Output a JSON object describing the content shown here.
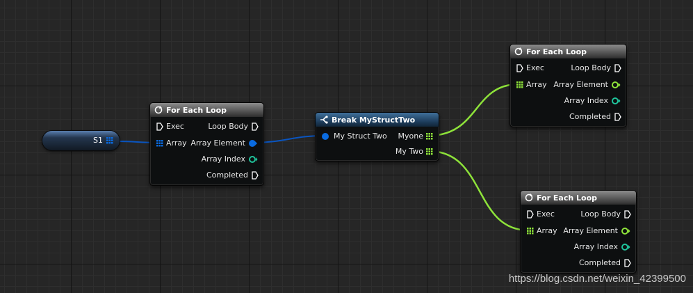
{
  "variable_node": {
    "label": "S1"
  },
  "for_each_loop_1": {
    "title": "For Each Loop",
    "inputs": [
      "Exec",
      "Array"
    ],
    "outputs": [
      "Loop Body",
      "Array Element",
      "Array Index",
      "Completed"
    ]
  },
  "break_node": {
    "title": "Break MyStructTwo",
    "input": "My Struct Two",
    "outputs": [
      "Myone",
      "My Two"
    ]
  },
  "for_each_loop_2": {
    "title": "For Each Loop",
    "inputs": [
      "Exec",
      "Array"
    ],
    "outputs": [
      "Loop Body",
      "Array Element",
      "Array Index",
      "Completed"
    ]
  },
  "for_each_loop_3": {
    "title": "For Each Loop",
    "inputs": [
      "Exec",
      "Array"
    ],
    "outputs": [
      "Loop Body",
      "Array Element",
      "Array Index",
      "Completed"
    ]
  },
  "colors": {
    "struct_pin": "#0a6be0",
    "array_pin": "#8ee33a",
    "index_pin": "#1fc39b",
    "exec_pin": "#ffffff"
  },
  "watermark": "https://blog.csdn.net/weixin_42399500"
}
